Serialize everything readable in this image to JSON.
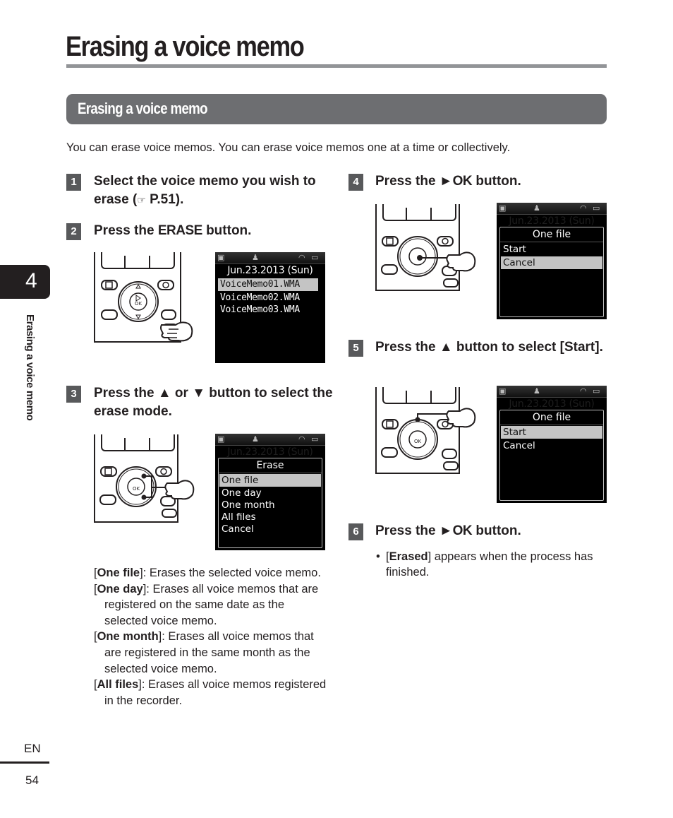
{
  "page": {
    "title": "Erasing a voice memo",
    "section_heading": "Erasing a voice memo",
    "intro": "You can erase voice memos. You can erase voice memos one at a time or collectively."
  },
  "steps": [
    {
      "number": "1",
      "text_parts": [
        "Select the voice memo you wish to erase (",
        "☞",
        " P.51)."
      ]
    },
    {
      "number": "2",
      "text_before": "Press the ",
      "key": "ERASE",
      "text_after": " button."
    },
    {
      "number": "3",
      "text_before": "Press the ",
      "up": "▲",
      "mid": " or ",
      "down": "▼",
      "text_after": " button to select the erase mode."
    },
    {
      "number": "4",
      "text_before": "Press the ",
      "play": "►",
      "key": "OK",
      "text_after": " button."
    },
    {
      "number": "5",
      "text_before": "Press the ",
      "up": "▲",
      "text_mid": " button to select [",
      "key": "Start",
      "text_after": "]."
    },
    {
      "number": "6",
      "text_before": "Press the ",
      "play": "►",
      "key": "OK",
      "text_after": " button."
    }
  ],
  "screens": {
    "date": "Jun.23.2013 (Sun)",
    "file_list": {
      "items": [
        "VoiceMemo01.WMA",
        "VoiceMemo02.WMA",
        "VoiceMemo03.WMA"
      ],
      "selected_index": 0
    },
    "erase_menu": {
      "title": "Erase",
      "items": [
        "One file",
        "One day",
        "One month",
        "All files",
        "Cancel"
      ],
      "selected_index": 0
    },
    "confirm_cancel": {
      "title": "One file",
      "items": [
        "Start",
        "Cancel"
      ],
      "selected_index": 1
    },
    "confirm_start": {
      "title": "One file",
      "items": [
        "Start",
        "Cancel"
      ],
      "selected_index": 0
    },
    "status_icons": [
      "memory-in-icon",
      "alarm-bell-icon",
      "wireless-icon",
      "battery-icon"
    ]
  },
  "device": {
    "ok_label": "OK"
  },
  "modes": [
    {
      "term": "One file",
      "desc": ": Erases the selected voice memo."
    },
    {
      "term": "One day",
      "desc": ": Erases all voice memos that are registered on the same date as the selected voice memo."
    },
    {
      "term": "One month",
      "desc": ": Erases all voice memos that are registered in the same month as the selected voice memo."
    },
    {
      "term": "All files",
      "desc": ": Erases all voice memos registered in the recorder."
    }
  ],
  "step6_note": {
    "bullet": "•",
    "term": "Erased",
    "desc": "] appears when the process has finished."
  },
  "sidebar": {
    "chapter": "4",
    "title": "Erasing a voice memo"
  },
  "footer": {
    "lang": "EN",
    "page": "54"
  }
}
